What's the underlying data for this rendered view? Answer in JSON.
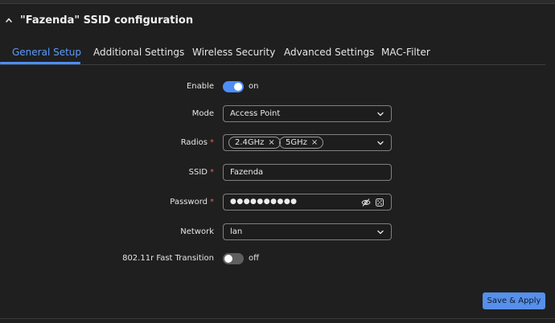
{
  "section": {
    "title": "\"Fazenda\" SSID configuration"
  },
  "tabs": [
    {
      "label": "General Setup",
      "active": true
    },
    {
      "label": "Additional Settings"
    },
    {
      "label": "Wireless Security"
    },
    {
      "label": "Advanced Settings"
    },
    {
      "label": "MAC-Filter"
    }
  ],
  "form": {
    "enable": {
      "label": "Enable",
      "state": "on"
    },
    "mode": {
      "label": "Mode",
      "value": "Access Point"
    },
    "radios": {
      "label": "Radios",
      "required_mark": "*",
      "chips": [
        "2.4GHz",
        "5GHz"
      ],
      "chip_remove": "×"
    },
    "ssid": {
      "label": "SSID",
      "required_mark": "*",
      "value": "Fazenda"
    },
    "password": {
      "label": "Password",
      "required_mark": "*",
      "masked_value": "●●●●●●●●●●"
    },
    "network": {
      "label": "Network",
      "value": "lan"
    },
    "fast_transition": {
      "label": "802.11r Fast Transition",
      "state": "off"
    }
  },
  "actions": {
    "save_label": "Save & Apply"
  },
  "colors": {
    "accent": "#4d8ef7",
    "active_tab": "#5b9bff",
    "required": "#f05a5a",
    "button": "#5690ea"
  },
  "icons": {
    "collapse": "chevron-up-icon",
    "dropdown": "chevron-down-icon",
    "hide_password": "eye-off-icon",
    "generate_password": "dice-icon"
  }
}
